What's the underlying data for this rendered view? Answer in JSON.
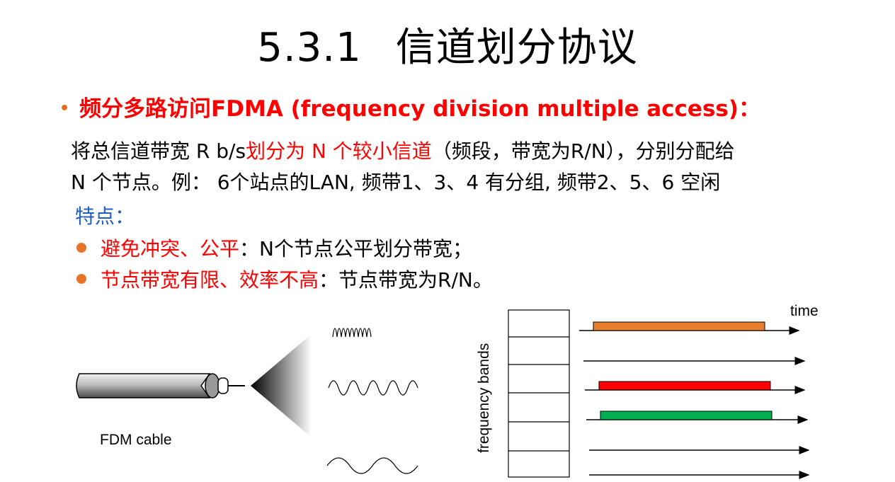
{
  "slide": {
    "title_number": "5.3.1",
    "title_text": "信道划分协议"
  },
  "bullet": {
    "heading": "频分多路访问FDMA (frequency division multiple access)："
  },
  "paragraph": {
    "line1_prefix": "将总信道带宽 R b/s",
    "line1_red": "划分为 N 个较小信道",
    "line1_suffix": "（频段，带宽为R/N），分别分配给",
    "line2": "N 个节点。例： 6个站点的LAN, 频带1、3、4 有分组, 频带2、5、6 空闲"
  },
  "features": {
    "heading": "特点：",
    "items": [
      {
        "red": "避免冲突、公平",
        "rest": "：N个节点公平划分带宽；"
      },
      {
        "red": "节点带宽有限、效率不高",
        "rest": "：节点带宽为R/N。"
      }
    ]
  },
  "figure": {
    "cable_label": "FDM cable",
    "y_label": "frequency bands",
    "x_label": "time",
    "bands": [
      {
        "band": 1,
        "busy": true,
        "color": "#e87f2e"
      },
      {
        "band": 2,
        "busy": false
      },
      {
        "band": 3,
        "busy": true,
        "color": "#ff0000"
      },
      {
        "band": 4,
        "busy": true,
        "color": "#00b050"
      },
      {
        "band": 5,
        "busy": false
      },
      {
        "band": 6,
        "busy": false
      }
    ]
  },
  "colors": {
    "heading_red": "#ff0000",
    "bullet_orange": "#e8742a",
    "feature_blue": "#1f5fbf"
  }
}
